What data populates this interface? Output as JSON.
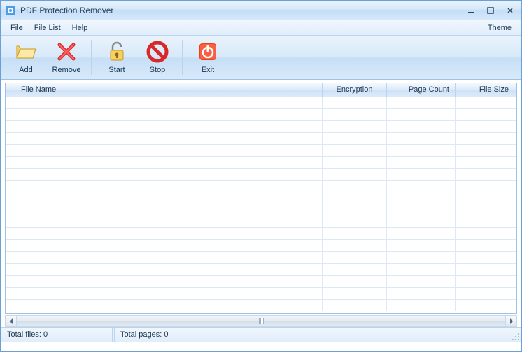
{
  "titlebar": {
    "title": "PDF Protection Remover"
  },
  "menu": {
    "file": "File",
    "filelist": "File List",
    "help": "Help",
    "theme": "Theme"
  },
  "toolbar": {
    "add": "Add",
    "remove": "Remove",
    "start": "Start",
    "stop": "Stop",
    "exit": "Exit"
  },
  "table": {
    "headers": {
      "filename": "File Name",
      "encryption": "Encryption",
      "pagecount": "Page Count",
      "filesize": "File Size"
    },
    "rows": []
  },
  "status": {
    "total_files": "Total files: 0",
    "total_pages": "Total pages: 0"
  }
}
